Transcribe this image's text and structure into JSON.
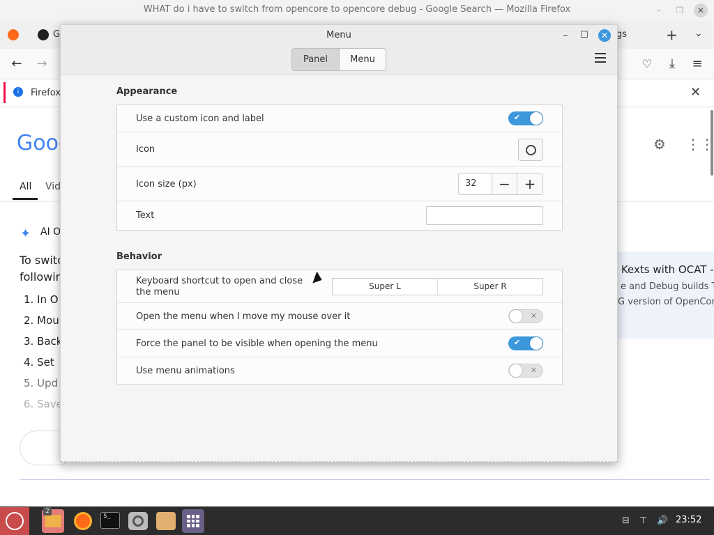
{
  "browser": {
    "window_title": "WHAT do i have to switch from opencore to opencore debug - Google Search — Mozilla Firefox",
    "tab_fragment_left": "G",
    "tab_fragment_right": "gs",
    "notification_text": "Firefox"
  },
  "google": {
    "logo_fragment": "Goog",
    "tabs": {
      "all": "All",
      "videos_fragment": "Vid"
    },
    "ai_overview_fragment": "AI O",
    "body_lines": [
      "To switc",
      "followin"
    ],
    "steps": [
      "1.  In O",
      "2.  Mou",
      "3.  Back",
      "4.  Set",
      "5.  Upd",
      "6.  Save"
    ],
    "result_title_fragment": "l Kexts with OCAT -",
    "result_snippet_lines": [
      "e and Debug builds To",
      "G version of OpenCore"
    ]
  },
  "dialog": {
    "title": "Menu",
    "tabs": {
      "panel": "Panel",
      "menu": "Menu"
    },
    "appearance": {
      "title": "Appearance",
      "custom_icon_label": "Use a custom icon and label",
      "custom_icon_enabled": true,
      "icon_label": "Icon",
      "icon_size_label": "Icon size (px)",
      "icon_size_value": "32",
      "text_label": "Text",
      "text_value": ""
    },
    "behavior": {
      "title": "Behavior",
      "shortcut_label": "Keyboard shortcut to open and close the menu",
      "shortcut_primary": "Super L",
      "shortcut_secondary": "Super R",
      "hover_label": "Open the menu when I move my mouse over it",
      "hover_enabled": false,
      "force_panel_label": "Force the panel to be visible when opening the menu",
      "force_panel_enabled": true,
      "animations_label": "Use menu animations",
      "animations_enabled": false
    }
  },
  "taskbar": {
    "files_badge": "2",
    "clock": "23:52"
  },
  "colors": {
    "accent": "#3c97db",
    "taskbar": "#2c2c2c",
    "mint_menu": "#c94b4b"
  }
}
